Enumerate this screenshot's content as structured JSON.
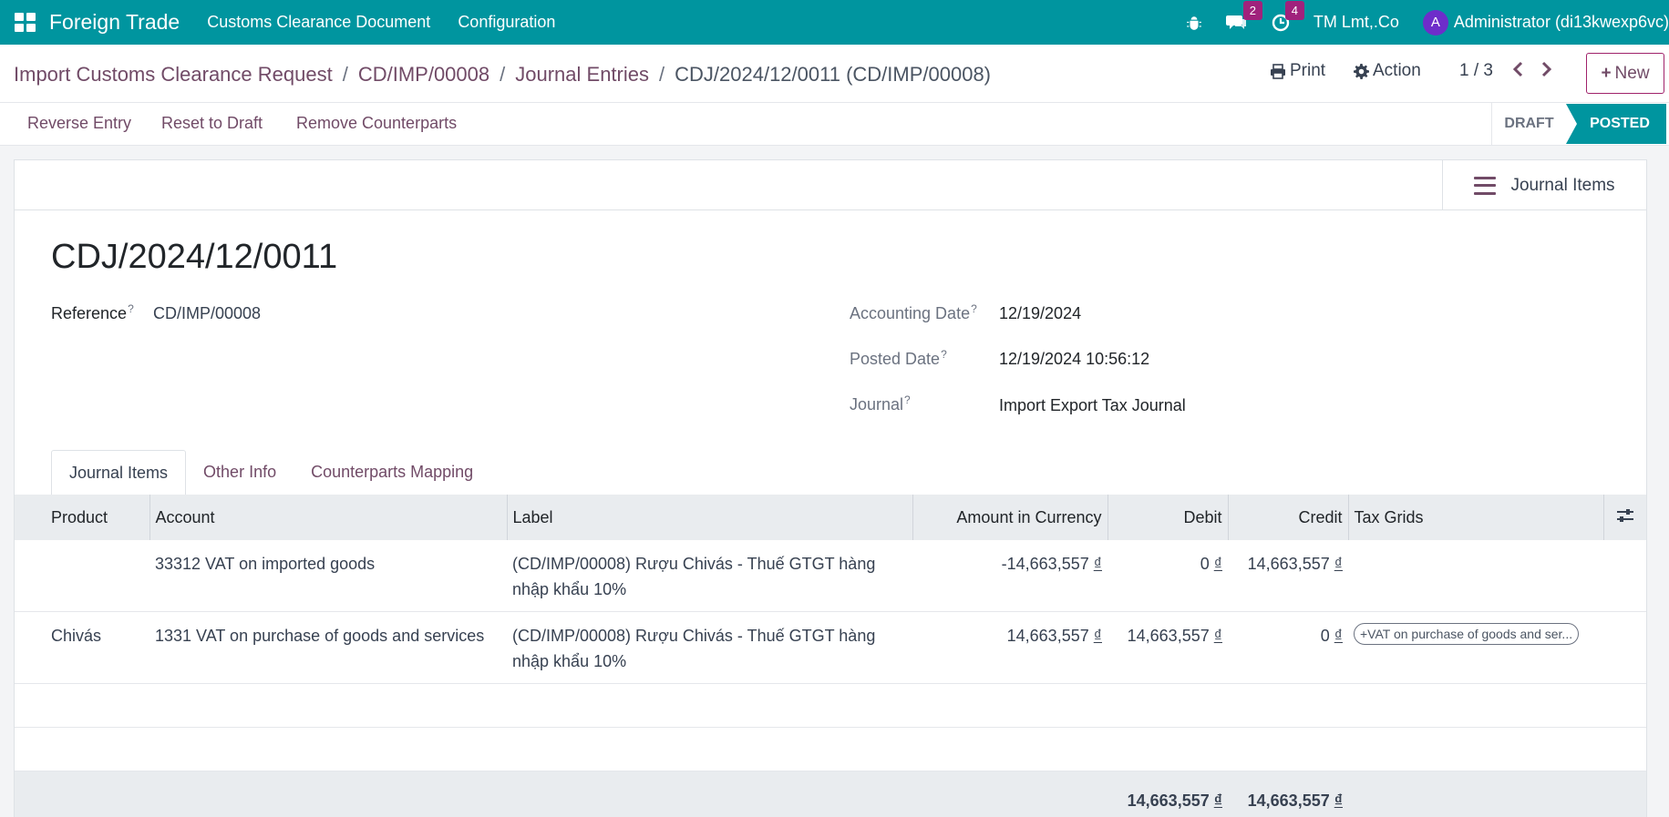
{
  "navbar": {
    "app_name": "Foreign Trade",
    "menus": [
      "Customs Clearance Document",
      "Configuration"
    ],
    "messages_count": "2",
    "activities_count": "4",
    "company": "TM Lmt,.Co",
    "user_initial": "A",
    "user_name": "Administrator (di13kwexp6vc)"
  },
  "breadcrumb": {
    "items": [
      "Import Customs Clearance Request",
      "CD/IMP/00008",
      "Journal Entries"
    ],
    "current": "CDJ/2024/12/0011 (CD/IMP/00008)"
  },
  "control": {
    "print_label": "Print",
    "action_label": "Action",
    "pager": "1 / 3",
    "new_label": "New"
  },
  "statusbar": {
    "buttons": [
      "Reverse Entry",
      "Reset to Draft",
      "Remove Counterparts"
    ],
    "stages": [
      "DRAFT",
      "POSTED"
    ],
    "current_stage": "POSTED"
  },
  "smart_button": {
    "label": "Journal Items"
  },
  "form": {
    "title": "CDJ/2024/12/0011",
    "reference_label": "Reference",
    "reference_value": "CD/IMP/00008",
    "accounting_date_label": "Accounting Date",
    "accounting_date_value": "12/19/2024",
    "posted_date_label": "Posted Date",
    "posted_date_value": "12/19/2024 10:56:12",
    "journal_label": "Journal",
    "journal_value": "Import Export Tax Journal",
    "help_mark": "?"
  },
  "tabs": [
    "Journal Items",
    "Other Info",
    "Counterparts Mapping"
  ],
  "table": {
    "headers": [
      "Product",
      "Account",
      "Label",
      "Amount in Currency",
      "Debit",
      "Credit",
      "Tax Grids"
    ],
    "rows": [
      {
        "product": "",
        "account": "33312 VAT on imported goods",
        "label": "(CD/IMP/00008) Rượu Chivás - Thuế GTGT hàng nhập khẩu 10%",
        "amount_currency": "-14,663,557",
        "debit": "0",
        "credit": "14,663,557",
        "tax_grid": ""
      },
      {
        "product": "Chivás",
        "account": "1331 VAT on purchase of goods and services",
        "label": "(CD/IMP/00008) Rượu Chivás - Thuế GTGT hàng nhập khẩu 10%",
        "amount_currency": "14,663,557",
        "debit": "14,663,557",
        "credit": "0",
        "tax_grid": "+VAT on purchase of goods and ser..."
      }
    ],
    "total_debit": "14,663,557",
    "total_credit": "14,663,557",
    "currency_symbol": "₫"
  }
}
